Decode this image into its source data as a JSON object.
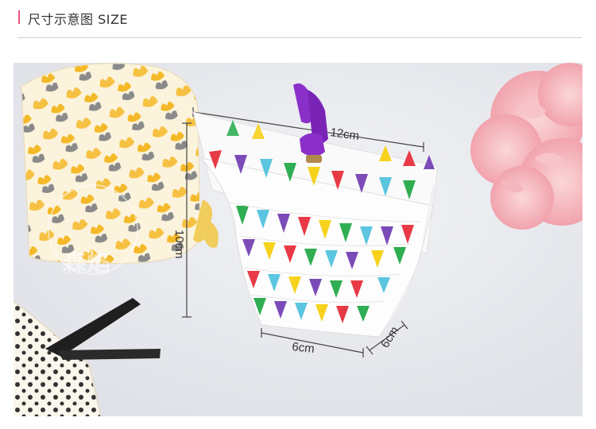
{
  "header": {
    "title": "尺寸示意图 SIZE"
  },
  "colors": {
    "accent": "#e8537a",
    "rule": "#cfcfcf",
    "background": "#e7e9ee"
  },
  "dimensions": {
    "width_label": "12cm",
    "height_label": "10cm",
    "base_label": "6cm",
    "depth_label": "6cm"
  },
  "watermark": {
    "text": "森焰"
  },
  "photo": {
    "objects": [
      "yellow-patterned-gift-bag",
      "bunting-pillow-gift-box",
      "purple-ribbon",
      "pink-flower",
      "polka-dot-box",
      "black-ribbon"
    ]
  }
}
